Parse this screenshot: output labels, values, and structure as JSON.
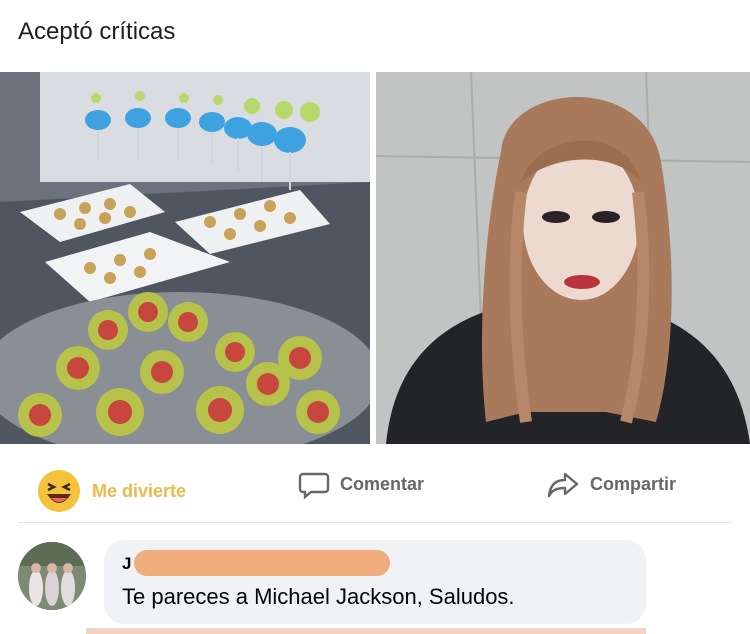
{
  "post": {
    "text": "Aceptó críticas"
  },
  "actions": {
    "react_label": "Me divierte",
    "comment_label": "Comentar",
    "share_label": "Compartir"
  },
  "comment": {
    "author": "J",
    "text": "Te pareces a Michael Jackson, Saludos."
  },
  "colors": {
    "reaction_accent": "#f0b84a",
    "secondary_text": "#65676b",
    "bubble_bg": "#f0f2f5",
    "redaction": "#f0a977"
  },
  "icons": {
    "react": "laughing-emoji-icon",
    "comment": "speech-bubble-icon",
    "share": "share-arrow-icon"
  }
}
